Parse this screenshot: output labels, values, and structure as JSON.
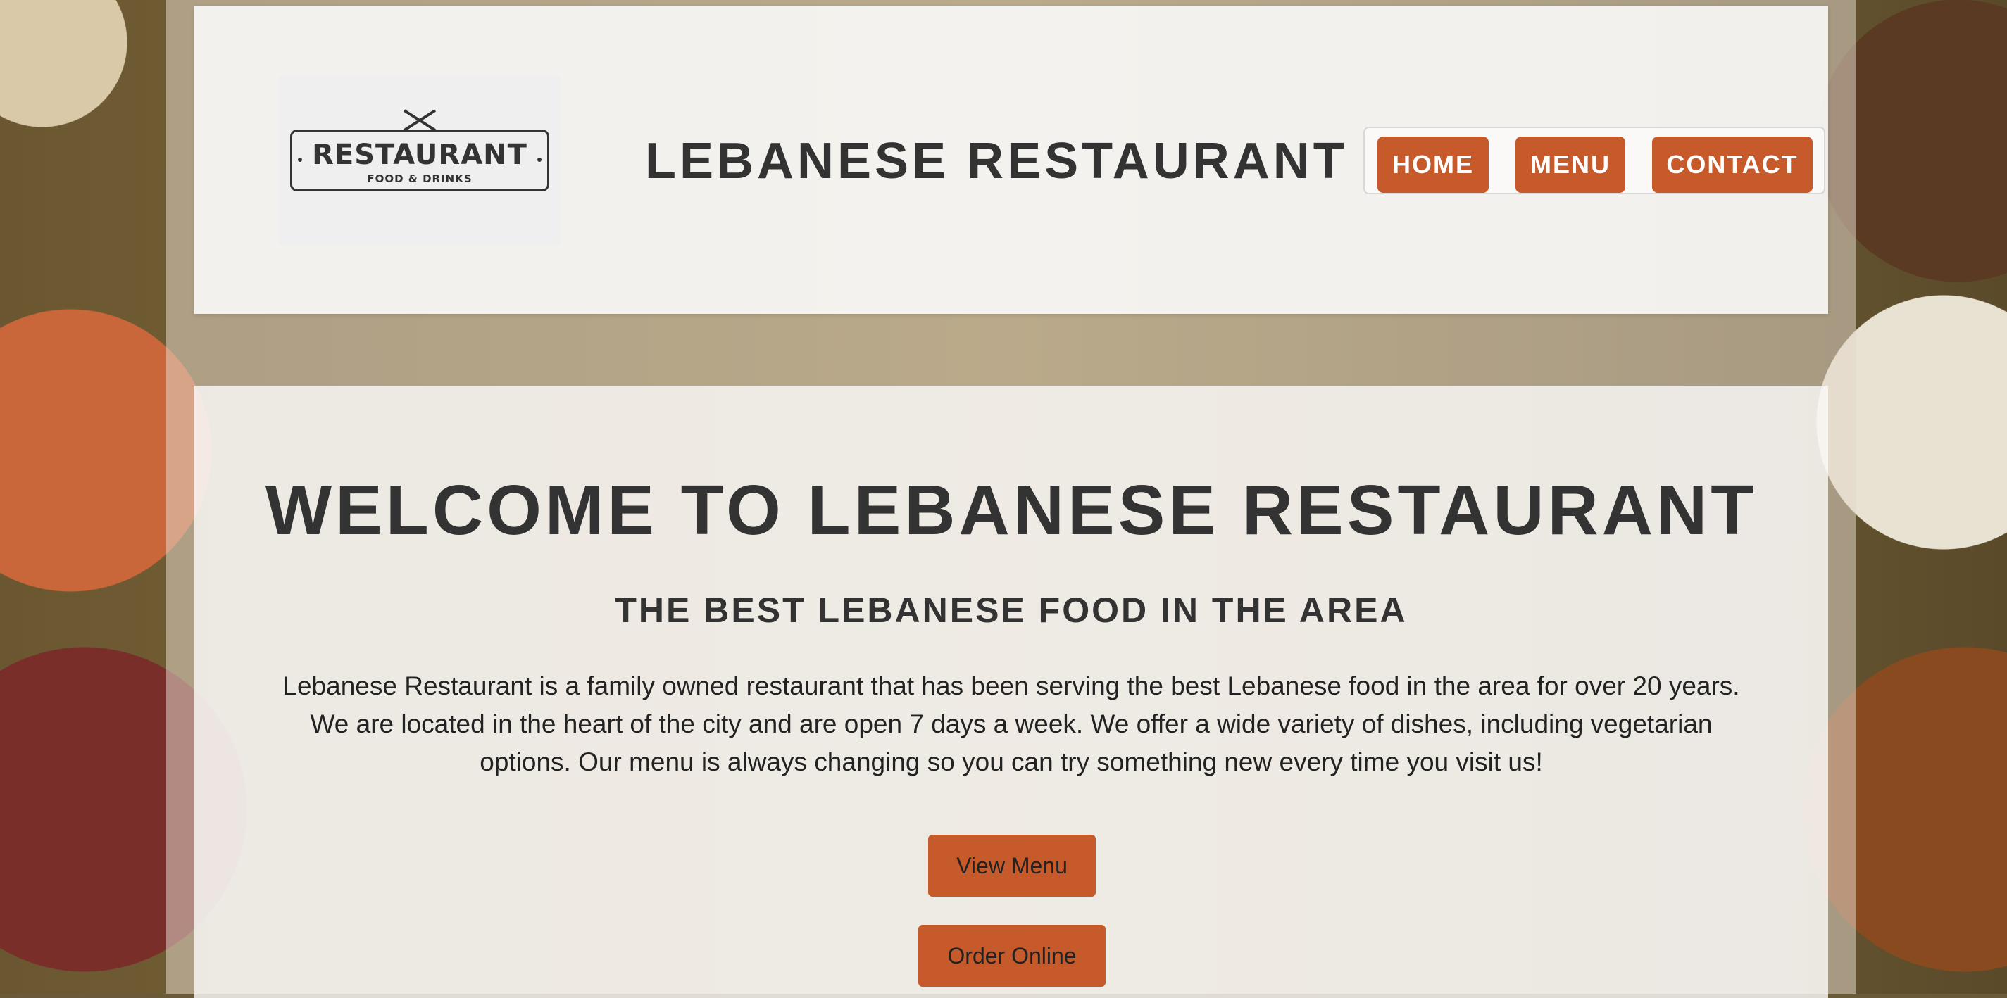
{
  "header": {
    "logo": {
      "main_text": "RESTAURANT",
      "sub_text": "FOOD & DRINKS"
    },
    "title": "LEBANESE RESTAURANT",
    "nav": [
      {
        "label": "HOME"
      },
      {
        "label": "MENU"
      },
      {
        "label": "CONTACT"
      }
    ]
  },
  "main": {
    "heading": "WELCOME TO LEBANESE RESTAURANT",
    "subheading": "THE BEST LEBANESE FOOD IN THE AREA",
    "description": "Lebanese Restaurant is a family owned restaurant that has been serving the best Lebanese food in the area for over 20 years. We are located in the heart of the city and are open 7 days a week. We offer a wide variety of dishes, including vegetarian options. Our menu is always changing so you can try something new every time you visit us!",
    "buttons": {
      "view_menu": "View Menu",
      "order_online": "Order Online"
    }
  },
  "colors": {
    "accent": "#c65a2a",
    "text": "#333333",
    "panel": "#faf9f8"
  }
}
